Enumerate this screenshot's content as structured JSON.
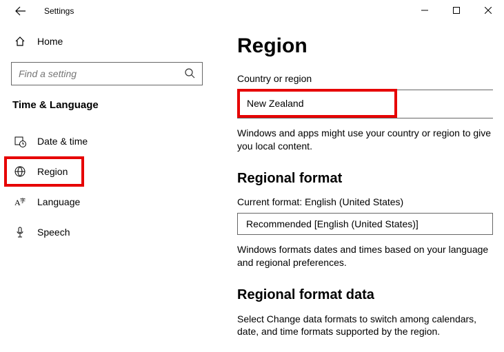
{
  "window": {
    "title": "Settings"
  },
  "sidebar": {
    "home": "Home",
    "search_placeholder": "Find a setting",
    "category": "Time & Language",
    "items": [
      {
        "label": "Date & time"
      },
      {
        "label": "Region"
      },
      {
        "label": "Language"
      },
      {
        "label": "Speech"
      }
    ]
  },
  "content": {
    "heading": "Region",
    "country_label": "Country or region",
    "country_value": "New Zealand",
    "country_desc": "Windows and apps might use your country or region to give you local content.",
    "format_heading": "Regional format",
    "current_format_label": "Current format: English (United States)",
    "format_value": "Recommended [English (United States)]",
    "format_desc": "Windows formats dates and times based on your language and regional preferences.",
    "data_heading": "Regional format data",
    "data_desc": "Select Change data formats to switch among calendars, date, and time formats supported by the region."
  }
}
